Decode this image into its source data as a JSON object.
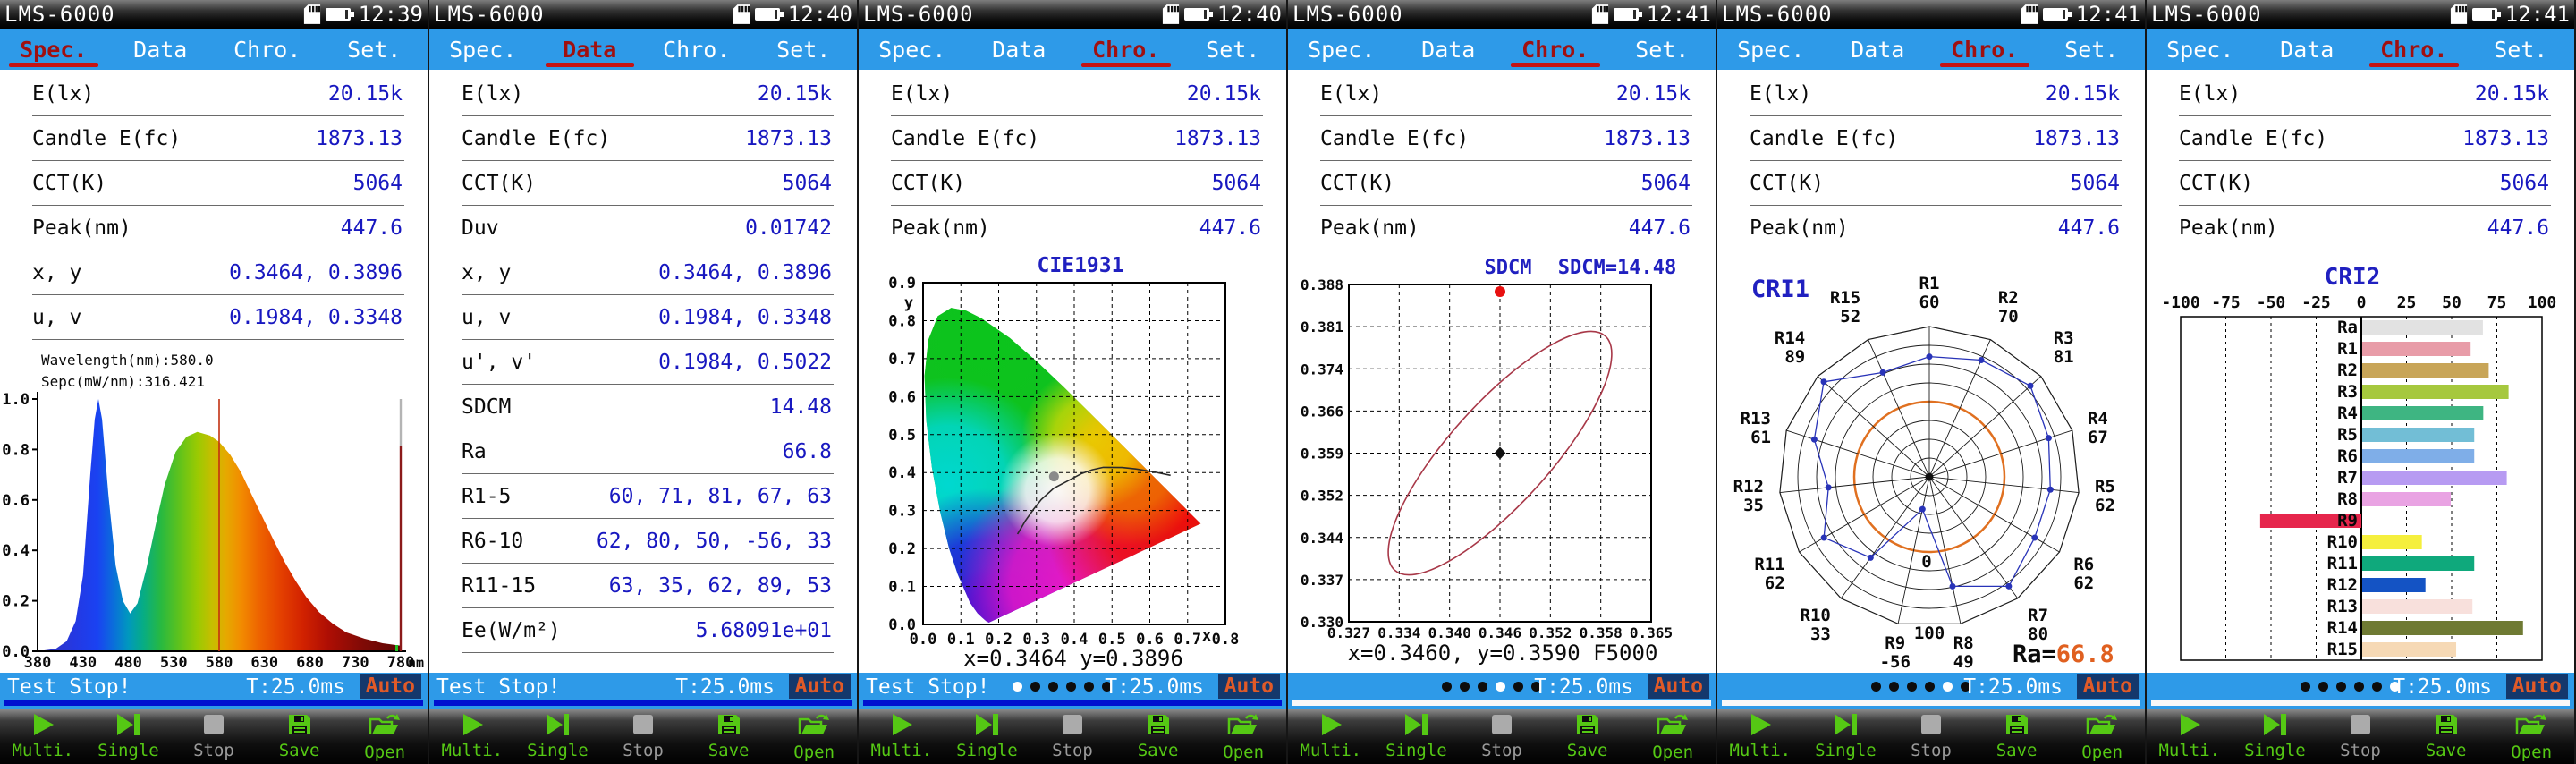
{
  "device": {
    "title": "LMS-6000",
    "tabs": [
      "Spec.",
      "Data",
      "Chro.",
      "Set."
    ]
  },
  "colors": {
    "bar_blue": "#2E9AE8",
    "value_blue": "#1818C0",
    "active_tab_red": "#A01010",
    "underline_red": "#C41414",
    "chart_title_blue": "#2020C0",
    "auto_text": "#E05A28",
    "auto_bg": "#14386C",
    "button_green": "#55C814",
    "progress_blue": "#0010D0",
    "progress_white": "#F8F8F8",
    "ra_orange": "#E06020",
    "ellipse_red": "#A83848"
  },
  "buttons": [
    {
      "label": "Multi.",
      "icon": "play-icon",
      "enabled": true
    },
    {
      "label": "Single",
      "icon": "skip-icon",
      "enabled": true
    },
    {
      "label": "Stop",
      "icon": "stop-icon",
      "enabled": false
    },
    {
      "label": "Save",
      "icon": "save-icon",
      "enabled": true
    },
    {
      "label": "Open",
      "icon": "open-icon",
      "enabled": true
    }
  ],
  "panels": [
    {
      "time": "12:39",
      "active_tab": 0,
      "type": "spec",
      "rows": [
        [
          "E(lx)",
          "20.15k"
        ],
        [
          "Candle E(fc)",
          "1873.13"
        ],
        [
          "CCT(K)",
          "5064"
        ],
        [
          "Peak(nm)",
          "447.6"
        ],
        [
          "x, y",
          "0.3464, 0.3896"
        ],
        [
          "u, v",
          "0.1984, 0.3348"
        ]
      ],
      "readout": [
        "Wavelength(nm):580.0",
        "Sepc(mW/nm):316.421"
      ],
      "status": {
        "left": "Test Stop!",
        "time": "T:25.0ms",
        "mode": "Auto",
        "dots": null,
        "progress": "#0010D0"
      }
    },
    {
      "time": "12:40",
      "active_tab": 1,
      "type": "data",
      "rows": [
        [
          "E(lx)",
          "20.15k"
        ],
        [
          "Candle E(fc)",
          "1873.13"
        ],
        [
          "CCT(K)",
          "5064"
        ],
        [
          "Duv",
          "0.01742"
        ],
        [
          "x, y",
          "0.3464, 0.3896"
        ],
        [
          "u, v",
          "0.1984, 0.3348"
        ],
        [
          "u', v'",
          "0.1984, 0.5022"
        ],
        [
          "SDCM",
          "14.48"
        ],
        [
          "Ra",
          "66.8"
        ],
        [
          "R1-5",
          "60, 71, 81, 67, 63"
        ],
        [
          "R6-10",
          "62, 80, 50, -56, 33"
        ],
        [
          "R11-15",
          "63, 35, 62, 89, 53"
        ],
        [
          "Ee(W/m²)",
          "5.68091e+01"
        ]
      ],
      "status": {
        "left": "Test Stop!",
        "time": "T:25.0ms",
        "mode": "Auto",
        "dots": null,
        "progress": "#0010D0"
      }
    },
    {
      "time": "12:40",
      "active_tab": 2,
      "type": "cie",
      "rows": [
        [
          "E(lx)",
          "20.15k"
        ],
        [
          "Candle E(fc)",
          "1873.13"
        ],
        [
          "CCT(K)",
          "5064"
        ],
        [
          "Peak(nm)",
          "447.6"
        ]
      ],
      "status": {
        "left": "Test Stop!",
        "time": "T:25.0ms",
        "mode": "Auto",
        "dots": 0,
        "progress": "#0010D0"
      }
    },
    {
      "time": "12:41",
      "active_tab": 2,
      "type": "sdcm",
      "rows": [
        [
          "E(lx)",
          "20.15k"
        ],
        [
          "Candle E(fc)",
          "1873.13"
        ],
        [
          "CCT(K)",
          "5064"
        ],
        [
          "Peak(nm)",
          "447.6"
        ]
      ],
      "status": {
        "left": "",
        "time": "T:25.0ms",
        "mode": "Auto",
        "dots": 3,
        "progress": "#F8F8F8"
      }
    },
    {
      "time": "12:41",
      "active_tab": 2,
      "type": "radar",
      "rows": [
        [
          "E(lx)",
          "20.15k"
        ],
        [
          "Candle E(fc)",
          "1873.13"
        ],
        [
          "CCT(K)",
          "5064"
        ],
        [
          "Peak(nm)",
          "447.6"
        ]
      ],
      "status": {
        "left": "",
        "time": "T:25.0ms",
        "mode": "Auto",
        "dots": 4,
        "progress": "#F8F8F8"
      }
    },
    {
      "time": "12:41",
      "active_tab": 2,
      "type": "bars",
      "rows": [
        [
          "E(lx)",
          "20.15k"
        ],
        [
          "Candle E(fc)",
          "1873.13"
        ],
        [
          "CCT(K)",
          "5064"
        ],
        [
          "Peak(nm)",
          "447.6"
        ]
      ],
      "status": {
        "left": "",
        "time": "T:25.0ms",
        "mode": "Auto",
        "dots": 5,
        "progress": "#F8F8F8"
      }
    }
  ],
  "chart_data": [
    {
      "panel": 1,
      "type": "area",
      "name": "spectrum",
      "x_ticks": [
        380,
        430,
        480,
        530,
        580,
        630,
        680,
        730,
        780
      ],
      "x_unit": "nm",
      "y_ticks": [
        "1.0",
        "0.8",
        "0.6",
        "0.4",
        "0.2",
        "0.0"
      ],
      "cursor_wavelength": 580.0,
      "cursor_value_mw_nm": 316.421,
      "peak_nm": 447.6,
      "points": [
        [
          380,
          0
        ],
        [
          400,
          0.01
        ],
        [
          412,
          0.04
        ],
        [
          422,
          0.12
        ],
        [
          430,
          0.3
        ],
        [
          438,
          0.7
        ],
        [
          443,
          0.92
        ],
        [
          447,
          1.0
        ],
        [
          451,
          0.92
        ],
        [
          458,
          0.62
        ],
        [
          466,
          0.34
        ],
        [
          474,
          0.2
        ],
        [
          482,
          0.15
        ],
        [
          490,
          0.19
        ],
        [
          500,
          0.33
        ],
        [
          510,
          0.5
        ],
        [
          520,
          0.66
        ],
        [
          532,
          0.79
        ],
        [
          544,
          0.85
        ],
        [
          556,
          0.87
        ],
        [
          570,
          0.855
        ],
        [
          580,
          0.83
        ],
        [
          592,
          0.78
        ],
        [
          604,
          0.71
        ],
        [
          616,
          0.62
        ],
        [
          628,
          0.53
        ],
        [
          640,
          0.44
        ],
        [
          652,
          0.355
        ],
        [
          664,
          0.28
        ],
        [
          676,
          0.215
        ],
        [
          690,
          0.155
        ],
        [
          705,
          0.11
        ],
        [
          720,
          0.075
        ],
        [
          740,
          0.05
        ],
        [
          760,
          0.032
        ],
        [
          780,
          0.022
        ]
      ]
    },
    {
      "panel": 3,
      "type": "scatter",
      "title": "CIE1931",
      "xlim": [
        0,
        0.8
      ],
      "ylim": [
        0,
        0.9
      ],
      "x_ticks": [
        "0.0",
        "0.1",
        "0.2",
        "0.3",
        "0.4",
        "0.5",
        "0.6",
        "0.7",
        "0.8"
      ],
      "y_ticks": [
        "0.0",
        "0.1",
        "0.2",
        "0.3",
        "0.4",
        "0.5",
        "0.6",
        "0.7",
        "0.8",
        "0.9"
      ],
      "x_axis_letter": "x",
      "y_axis_letter": "y",
      "point": [
        0.3464,
        0.3896
      ],
      "caption": "x=0.3464 y=0.3896"
    },
    {
      "panel": 4,
      "type": "scatter",
      "title": "SDCM",
      "subtitle": "SDCM=14.48",
      "x_ticks": [
        "0.327",
        "0.334",
        "0.340",
        "0.346",
        "0.352",
        "0.358",
        "0.365"
      ],
      "y_ticks": [
        "0.388",
        "0.381",
        "0.374",
        "0.366",
        "0.359",
        "0.352",
        "0.344",
        "0.337",
        "0.330"
      ],
      "center": [
        0.346,
        0.359
      ],
      "measured": [
        0.346,
        0.3878
      ],
      "caption": "x=0.3460, y=0.3590 F5000"
    },
    {
      "panel": 5,
      "type": "radar",
      "title": "CRI1",
      "categories": [
        "R1",
        "R2",
        "R3",
        "R4",
        "R5",
        "R6",
        "R7",
        "R8",
        "R9",
        "R10",
        "R11",
        "R12",
        "R13",
        "R14",
        "R15"
      ],
      "values": [
        60,
        70,
        81,
        67,
        62,
        62,
        80,
        49,
        -56,
        33,
        62,
        35,
        61,
        89,
        52
      ],
      "range": [
        -100,
        100
      ],
      "zero_label": "0",
      "outer_label": "100",
      "ra_label": "Ra=",
      "ra_value": "66.8"
    },
    {
      "panel": 6,
      "type": "bar",
      "title": "CRI2",
      "x_ticks": [
        "-100",
        "-75",
        "-50",
        "-25",
        "0",
        "25",
        "50",
        "75",
        "100"
      ],
      "xlim": [
        -100,
        100
      ],
      "categories": [
        "Ra",
        "R1",
        "R2",
        "R3",
        "R4",
        "R5",
        "R6",
        "R7",
        "R8",
        "R9",
        "R10",
        "R11",
        "R12",
        "R13",
        "R14",
        "R15"
      ],
      "values": [
        66.8,
        60,
        70,
        81,
        67,
        62,
        62,
        80,
        49,
        -56,
        33,
        62,
        35,
        61,
        89,
        52
      ],
      "colors": [
        "#E2E2E2",
        "#E89CA8",
        "#C8A558",
        "#A6C83E",
        "#3EB582",
        "#72BED6",
        "#7FAEE8",
        "#B79BF2",
        "#E9A3E3",
        "#E6264C",
        "#F5EF3D",
        "#0FA97C",
        "#1453C4",
        "#F8E0DC",
        "#6F7A33",
        "#F6D9B5"
      ]
    }
  ]
}
